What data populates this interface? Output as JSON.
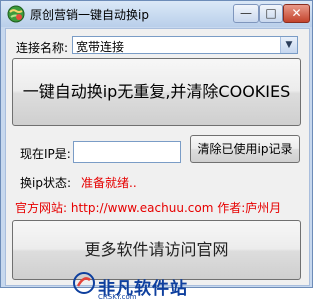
{
  "window": {
    "title": "原创营销一键自动换ip",
    "minimize_glyph": "—",
    "maximize_glyph": "□",
    "close_glyph": "✕"
  },
  "connection": {
    "label": "连接名称:",
    "selected": "宽带连接"
  },
  "main_button": {
    "label": "一键自动换ip无重复,并清除COOKIES"
  },
  "ip": {
    "label": "现在IP是:",
    "value": ""
  },
  "clear_button": {
    "label": "清除已使用ip记录"
  },
  "status": {
    "label": "换ip状态:",
    "value": "准备就绪.."
  },
  "footer": {
    "site_label": "官方网站:",
    "site_url": "http://www.eachuu.com",
    "author_label": "作者:",
    "author": "庐州月"
  },
  "bottom_button": {
    "label": "更多软件请访问官网"
  },
  "watermark": {
    "text": "非凡软件站",
    "sub": "CRSKY.com"
  },
  "colors": {
    "status": "#e60000",
    "watermark": "#0e3f9e"
  },
  "icons": {
    "app": "globe-icon",
    "dropdown": "chevron-down-icon"
  }
}
